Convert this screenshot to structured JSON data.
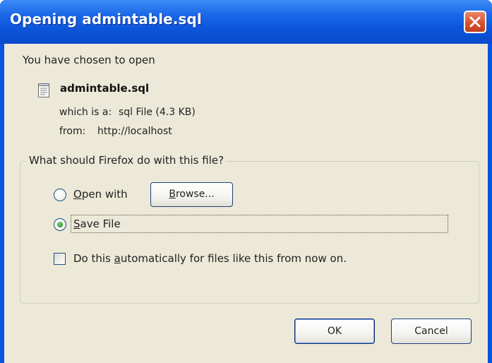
{
  "window": {
    "title": "Opening admintable.sql"
  },
  "dialog": {
    "intro": "You have chosen to open",
    "file_name": "admintable.sql",
    "type_label": "which is a:",
    "type_value": "sql File (4.3 KB)",
    "from_label": "from:",
    "from_value": "http://localhost",
    "file_icon": "text-file-icon"
  },
  "action_group": {
    "legend": "What should Firefox do with this file?",
    "options": [
      {
        "label_first": "O",
        "label_rest": "pen with",
        "selected": false
      },
      {
        "label_first": "S",
        "label_rest": "ave File",
        "selected": true
      }
    ],
    "browse_first": "B",
    "browse_rest": "rowse...",
    "auto_pre": "Do this ",
    "auto_accel": "a",
    "auto_post": "utomatically for files like this from now on.",
    "auto_checked": false
  },
  "buttons": {
    "ok": "OK",
    "cancel": "Cancel"
  },
  "colors": {
    "titlebar": "#0a53e0",
    "close": "#d6532e",
    "client": "#ece9d8",
    "radio_dot": "#2a9a2a"
  }
}
